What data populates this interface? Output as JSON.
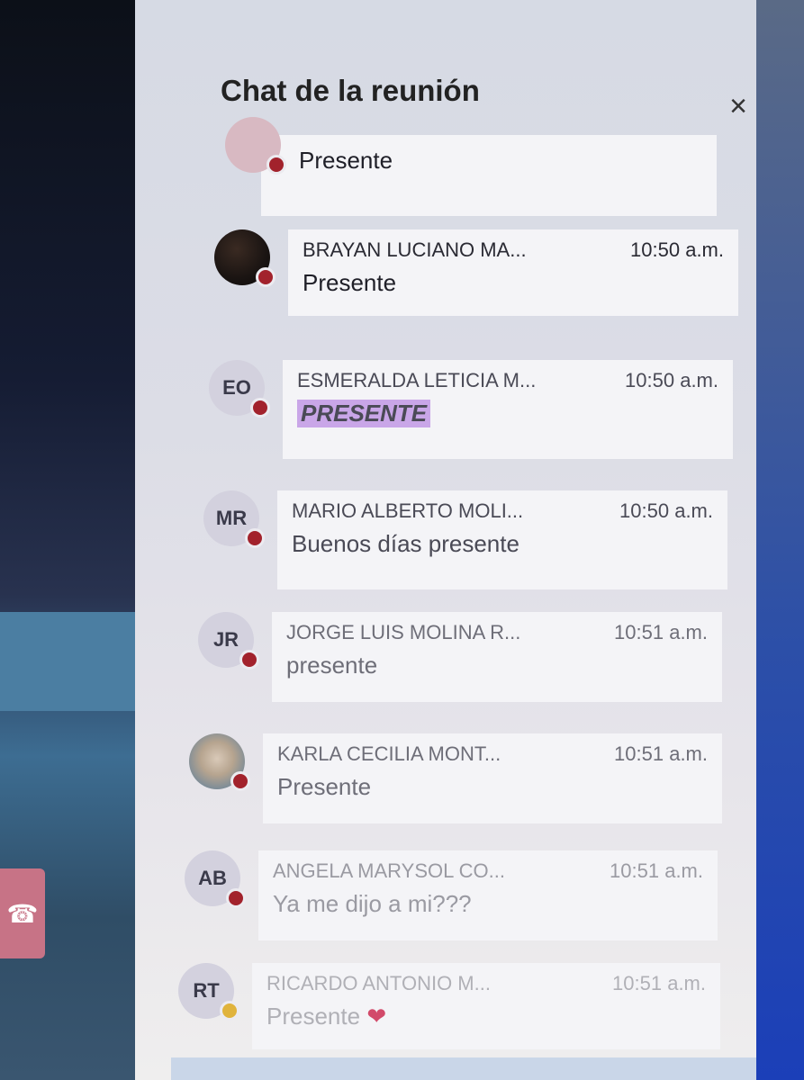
{
  "panel": {
    "title": "Chat de la reunión",
    "close_label": "×"
  },
  "messages": [
    {
      "initials": "",
      "name": "",
      "time": "",
      "text": "Presente"
    },
    {
      "initials": "",
      "name": "BRAYAN LUCIANO MA...",
      "time": "10:50 a.m.",
      "text": "Presente"
    },
    {
      "initials": "EO",
      "name": "ESMERALDA LETICIA M...",
      "time": "10:50 a.m.",
      "text": "PRESENTE"
    },
    {
      "initials": "MR",
      "name": "MARIO ALBERTO MOLI...",
      "time": "10:50 a.m.",
      "text": "Buenos días presente"
    },
    {
      "initials": "JR",
      "name": "JORGE LUIS MOLINA R...",
      "time": "10:51 a.m.",
      "text": "presente"
    },
    {
      "initials": "",
      "name": "KARLA CECILIA MONT...",
      "time": "10:51 a.m.",
      "text": "Presente"
    },
    {
      "initials": "AB",
      "name": "ANGELA MARYSOL CO...",
      "time": "10:51 a.m.",
      "text": "Ya me dijo a mi???"
    },
    {
      "initials": "RT",
      "name": "RICARDO ANTONIO M...",
      "time": "10:51 a.m.",
      "text": "Presente",
      "emoji": "❤"
    }
  ],
  "colors": {
    "status_busy": "#a2222c",
    "status_away": "#e0b33c",
    "highlight": "#c9a6e8"
  }
}
